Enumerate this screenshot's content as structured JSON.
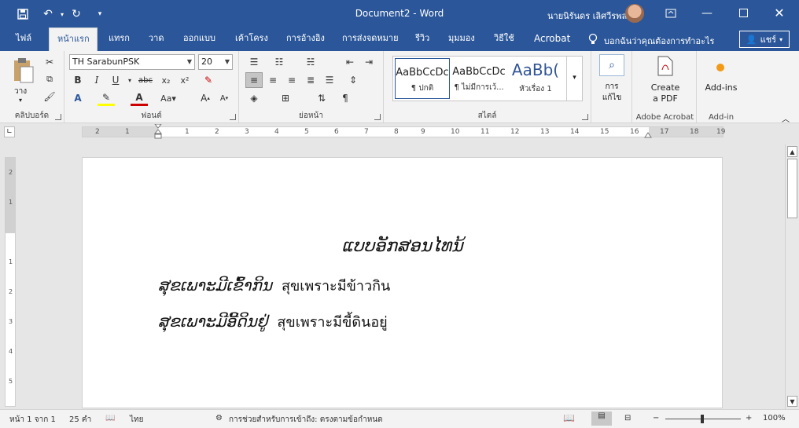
{
  "titlebar": {
    "title": "Document2  -  Word",
    "user": "นายนิรันดร เลิศวีรพล",
    "qat": {
      "save": "save-icon",
      "undo": "undo-icon",
      "redo": "redo-icon",
      "customize": "customize-icon"
    }
  },
  "tabs": [
    "ไฟล์",
    "หน้าแรก",
    "แทรก",
    "วาด",
    "ออกแบบ",
    "เค้าโครง",
    "การอ้างอิง",
    "การส่งจดหมาย",
    "รีวิว",
    "มุมมอง",
    "วิธีใช้",
    "Acrobat"
  ],
  "active_tab": "หน้าแรก",
  "tell_me": "บอกฉันว่าคุณต้องการทำอะไร",
  "share_label": "แชร์",
  "ribbon": {
    "clipboard": {
      "label": "คลิปบอร์ด",
      "paste": "วาง"
    },
    "font": {
      "label": "ฟอนต์",
      "name": "TH SarabunPSK",
      "size": "20"
    },
    "paragraph": {
      "label": "ย่อหน้า"
    },
    "styles": {
      "label": "สไตล์",
      "items": [
        {
          "sample": "AaBbCcDc",
          "name": "¶ ปกติ"
        },
        {
          "sample": "AaBbCcDc",
          "name": "¶ ไม่มีการเว้..."
        },
        {
          "sample": "AaBb(",
          "name": "หัวเรื่อง 1"
        }
      ]
    },
    "editing": {
      "label1": "การ",
      "label2": "แก้ไข"
    },
    "acrobat": {
      "label": "Adobe Acrobat",
      "btn1": "Create",
      "btn2": "a PDF"
    },
    "addins": {
      "label": "Add-in",
      "btn": "Add-ins"
    }
  },
  "ruler_numbers": [
    "2",
    "1",
    "1",
    "2",
    "3",
    "4",
    "5",
    "6",
    "7",
    "8",
    "9",
    "10",
    "11",
    "12",
    "13",
    "14",
    "15",
    "16",
    "17",
    "18",
    "19"
  ],
  "vruler_numbers": [
    "2",
    "1",
    "1",
    "2",
    "3",
    "4",
    "5"
  ],
  "document": {
    "title": "ແບບອັກສອນໄທນ້",
    "lines": [
      {
        "lao": "ສຸຂເພາະມີເຂົ້າກິນ",
        "thai": "สุขเพราะมีข้าวกิน"
      },
      {
        "lao": "ສຸຂເພາະມີອີ້ດິນຢູ່",
        "thai": "สุขเพราะมีขี้ดินอยู่"
      }
    ]
  },
  "status": {
    "page": "หน้า 1 จาก 1",
    "words": "25 คำ",
    "lang": "ไทย",
    "accessibility": "การช่วยสำหรับการเข้าถึง: ตรงตามข้อกำหนด",
    "zoom": "100%"
  }
}
